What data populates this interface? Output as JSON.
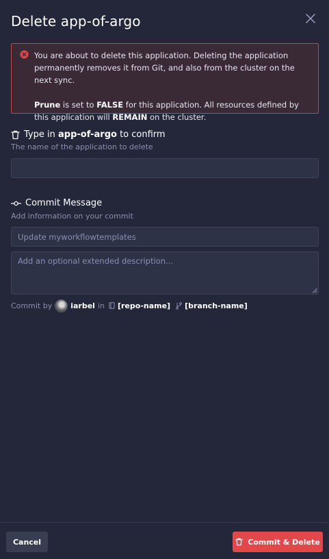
{
  "dialog": {
    "title": "Delete app-of-argo",
    "close_icon": "close-icon"
  },
  "alert": {
    "icon": "error-circle-icon",
    "message": "You are about to delete this application. Deleting the application permanently removes it from Git, and also from the cluster on the next sync.",
    "prune_label": "Prune",
    "prune_text_1": " is set to ",
    "prune_value": "FALSE",
    "prune_text_2": " for this application. All resources defined by this application will ",
    "remain_label": "REMAIN",
    "prune_text_3": " on the cluster."
  },
  "confirm": {
    "icon": "trash-icon",
    "title_prefix": "Type in ",
    "app_name": "app-of-argo",
    "title_suffix": " to confirm",
    "helper": "The name of the application to delete",
    "value": "",
    "placeholder": ""
  },
  "commit": {
    "icon": "git-commit-icon",
    "title": "Commit Message",
    "helper": "Add information on your commit",
    "message_placeholder": "Update myworkflowtemplates",
    "description_placeholder": "Add an optional extended description...",
    "by_label": "Commit by",
    "user": "iarbel",
    "in_label": "in",
    "repo": "[repo-name]",
    "branch": "[branch-name]"
  },
  "footer": {
    "cancel_label": "Cancel",
    "delete_label": "Commit & Delete",
    "delete_color": "#e0484c"
  },
  "colors": {
    "background": "#232739",
    "alert_border": "#c04848",
    "alert_bg": "#3a2a35",
    "error": "#e0484c"
  }
}
